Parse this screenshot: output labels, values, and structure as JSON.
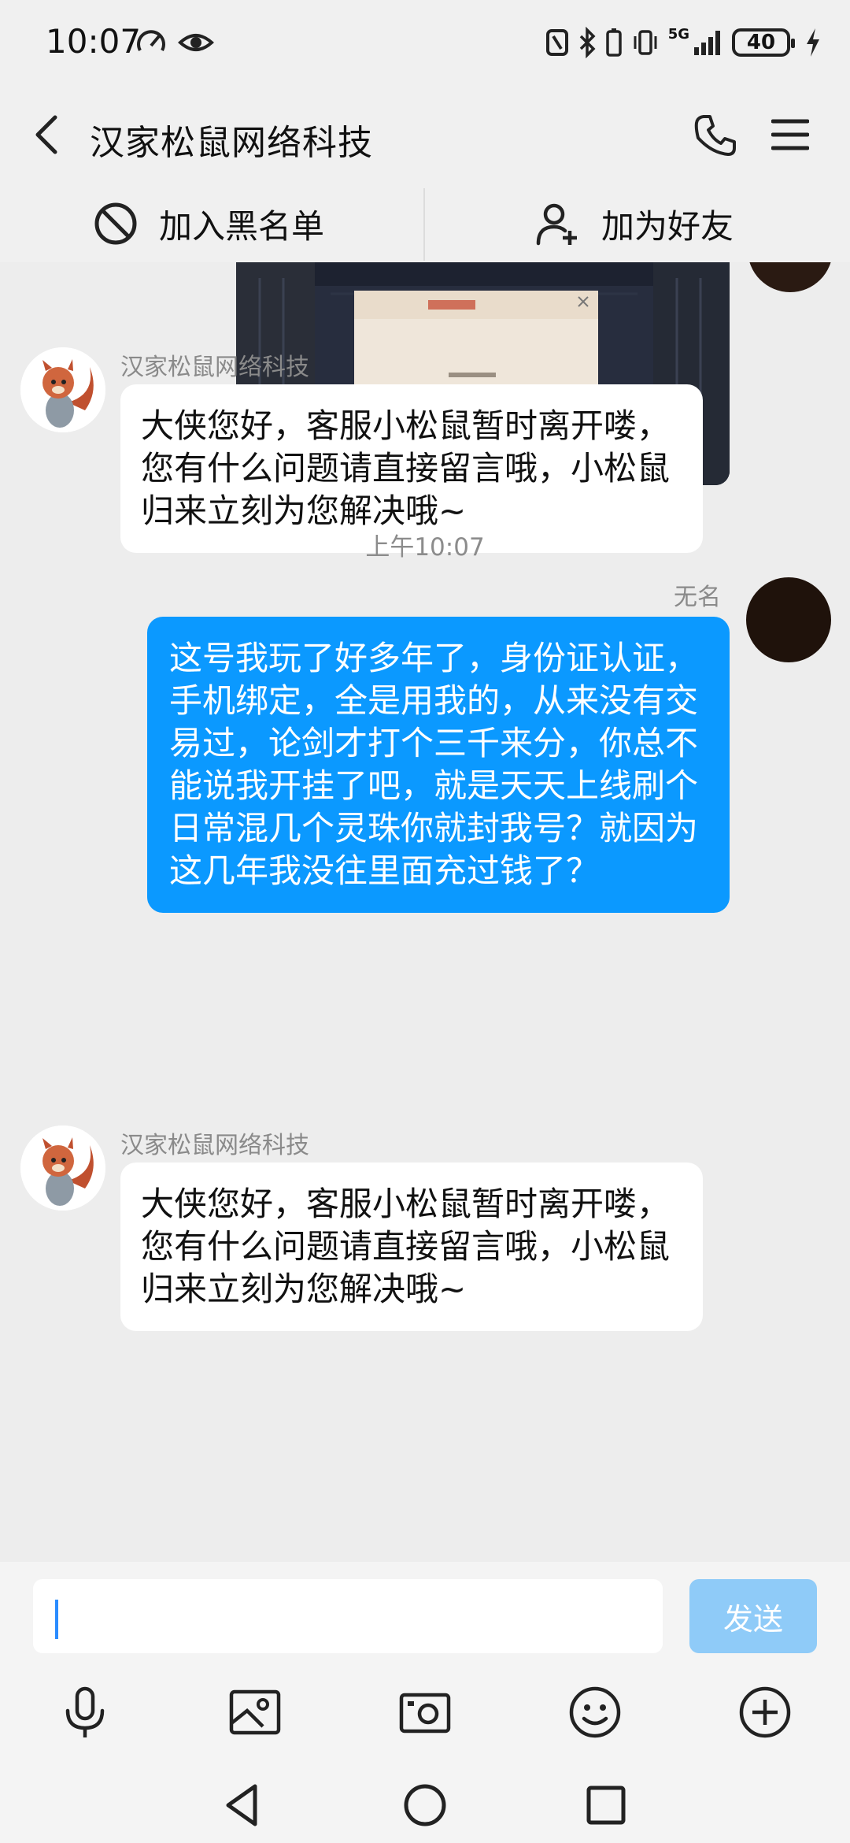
{
  "status_bar": {
    "time": "10:07",
    "network": "5G",
    "battery": "40"
  },
  "header": {
    "title": "汉家松鼠网络科技"
  },
  "actions": {
    "block_label": "加入黑名单",
    "add_friend_label": "加为好友"
  },
  "messages": [
    {
      "sender": "汉家松鼠网络科技",
      "text": "大侠您好，客服小松鼠暂时离开喽，您有什么问题请直接留言哦，小松鼠归来立刻为您解决哦~"
    },
    {
      "time": "上午10:07"
    },
    {
      "sender": "无名",
      "text": "这号我玩了好多年了，身份证认证，手机绑定，全是用我的，从来没有交易过，论剑才打个三千来分，你总不能说我开挂了吧，就是天天上线刷个日常混几个灵珠你就封我号？就因为这几年我没往里面充过钱了？"
    },
    {
      "sender": "汉家松鼠网络科技",
      "text": "大侠您好，客服小松鼠暂时离开喽，您有什么问题请直接留言哦，小松鼠归来立刻为您解决哦~"
    }
  ],
  "input": {
    "value": "",
    "send_label": "发送"
  },
  "colors": {
    "outgoing_bubble": "#0b99ff",
    "send_button": "#8fcbf8",
    "background": "#ededed"
  },
  "icons": [
    "back-icon",
    "phone-icon",
    "menu-icon",
    "block-icon",
    "add-friend-icon",
    "microphone-icon",
    "image-icon",
    "camera-icon",
    "emoji-icon",
    "plus-icon",
    "nav-back-icon",
    "nav-home-icon",
    "nav-recents-icon"
  ]
}
